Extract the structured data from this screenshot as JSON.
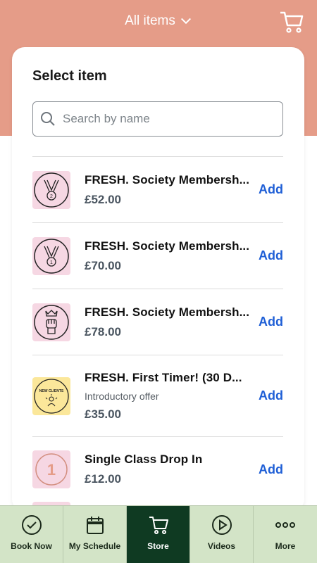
{
  "header": {
    "title": "All items"
  },
  "card": {
    "title": "Select item",
    "search_placeholder": "Search by name"
  },
  "items": [
    {
      "name": "FRESH. Society Membersh...",
      "price": "£52.00",
      "add": "Add",
      "icon": "medal-2-icon",
      "sub": ""
    },
    {
      "name": "FRESH. Society Membersh...",
      "price": "£70.00",
      "add": "Add",
      "icon": "medal-1-icon",
      "sub": ""
    },
    {
      "name": "FRESH. Society Membersh...",
      "price": "£78.00",
      "add": "Add",
      "icon": "fist-crown-icon",
      "sub": ""
    },
    {
      "name": "FRESH. First Timer! (30 D...",
      "price": "£35.00",
      "add": "Add",
      "icon": "new-clients-badge-icon",
      "sub": "Introductory offer",
      "badge_text": "NEW CLIENTS"
    },
    {
      "name": "Single Class Drop In",
      "price": "£12.00",
      "add": "Add",
      "icon": "number-1-icon",
      "sub": "",
      "badge_text": "1"
    }
  ],
  "nav": [
    {
      "label": "Book Now",
      "icon": "check-circle-icon"
    },
    {
      "label": "My Schedule",
      "icon": "calendar-icon"
    },
    {
      "label": "Store",
      "icon": "cart-icon"
    },
    {
      "label": "Videos",
      "icon": "play-circle-icon"
    },
    {
      "label": "More",
      "icon": "more-dots-icon"
    }
  ],
  "colors": {
    "header_bg": "#e59c88",
    "accent_link": "#1f5fd6",
    "nav_bg": "#d3e4c7",
    "nav_active": "#0f3a22"
  }
}
